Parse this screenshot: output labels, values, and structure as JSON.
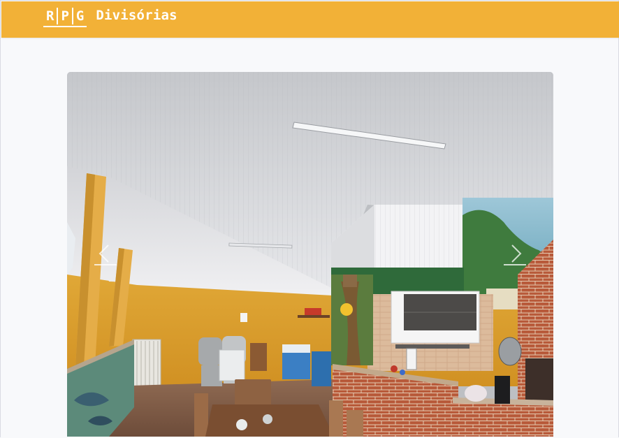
{
  "header": {
    "logo_letters": [
      "R",
      "P",
      "G"
    ],
    "brand_name": "Divisórias",
    "background_color": "#f2b137"
  },
  "carousel": {
    "previous_icon": "chevron-left-icon",
    "next_icon": "chevron-right-icon"
  }
}
